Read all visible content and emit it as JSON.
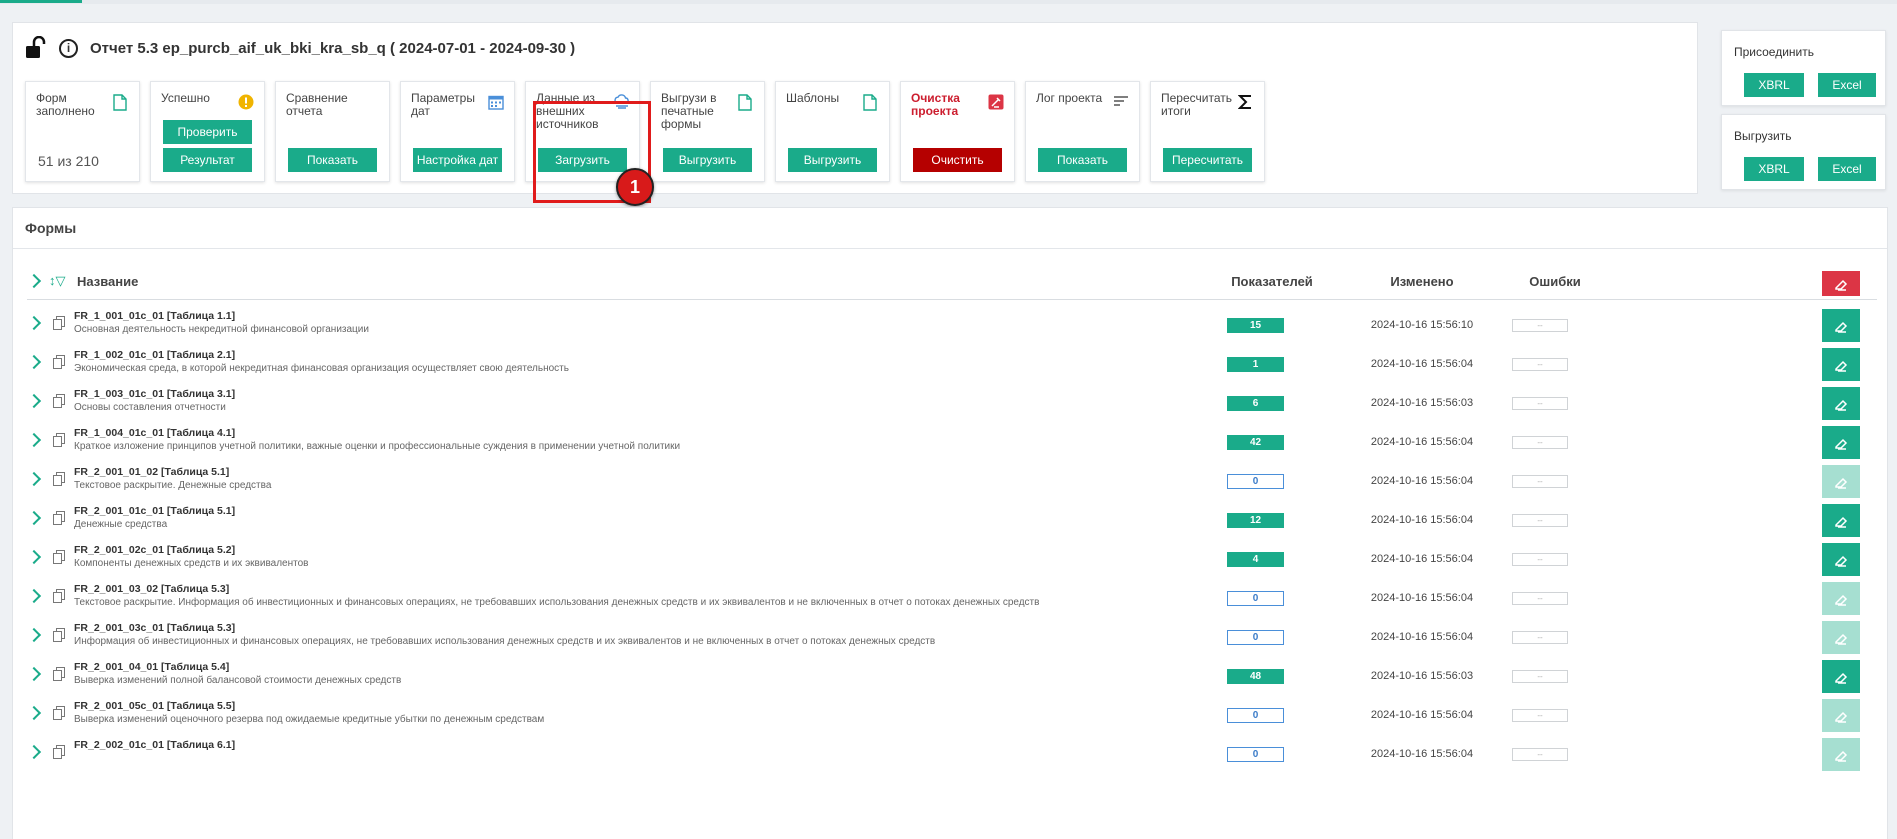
{
  "report": {
    "title": "Отчет 5.3 ep_purcb_aif_uk_bki_kra_sb_q ( 2024-07-01 - 2024-09-30 )"
  },
  "tiles": [
    {
      "label": "Форм заполнено",
      "count": "51 из 210"
    },
    {
      "label": "Успешно",
      "button1": "Проверить",
      "button2": "Результат"
    },
    {
      "label": "Сравнение отчета",
      "button2": "Показать"
    },
    {
      "label": "Параметры дат",
      "button2": "Настройка дат"
    },
    {
      "label": "Данные из внешних источников",
      "button2": "Загрузить"
    },
    {
      "label": "Выгрузи в печатные формы",
      "button2": "Выгрузить"
    },
    {
      "label": "Шаблоны",
      "button2": "Выгрузить"
    },
    {
      "label": "Очистка проекта",
      "button2": "Очистить"
    },
    {
      "label": "Лог проекта",
      "button2": "Показать"
    },
    {
      "label": "Пересчитать итоги",
      "button2": "Пересчитать"
    }
  ],
  "annotation": {
    "number": "1"
  },
  "attach": {
    "label": "Присоединить",
    "xbrl": "XBRL",
    "excel": "Excel"
  },
  "export": {
    "label": "Выгрузить",
    "xbrl": "XBRL",
    "excel": "Excel"
  },
  "forms": {
    "title": "Формы",
    "headers": {
      "name": "Название",
      "count": "Показателей",
      "modified": "Изменено",
      "errors": "Ошибки"
    },
    "rows": [
      {
        "name": "FR_1_001_01c_01 [Таблица 1.1]",
        "desc": "Основная деятельность некредитной финансовой организации",
        "count": "15",
        "filled": true,
        "modified": "2024-10-16 15:56:10",
        "errors": "--"
      },
      {
        "name": "FR_1_002_01c_01 [Таблица 2.1]",
        "desc": "Экономическая среда, в которой некредитная финансовая организация осуществляет свою деятельность",
        "count": "1",
        "filled": true,
        "modified": "2024-10-16 15:56:04",
        "errors": "--"
      },
      {
        "name": "FR_1_003_01c_01 [Таблица 3.1]",
        "desc": "Основы составления отчетности",
        "count": "6",
        "filled": true,
        "modified": "2024-10-16 15:56:03",
        "errors": "--"
      },
      {
        "name": "FR_1_004_01c_01 [Таблица 4.1]",
        "desc": "Краткое изложение принципов учетной политики, важные оценки и профессиональные суждения в применении учетной политики",
        "count": "42",
        "filled": true,
        "modified": "2024-10-16 15:56:04",
        "errors": "--"
      },
      {
        "name": "FR_2_001_01_02 [Таблица 5.1]",
        "desc": "Текстовое раскрытие. Денежные средства",
        "count": "0",
        "filled": false,
        "modified": "2024-10-16 15:56:04",
        "errors": "--"
      },
      {
        "name": "FR_2_001_01c_01 [Таблица 5.1]",
        "desc": "Денежные средства",
        "count": "12",
        "filled": true,
        "modified": "2024-10-16 15:56:04",
        "errors": "--"
      },
      {
        "name": "FR_2_001_02c_01 [Таблица 5.2]",
        "desc": "Компоненты денежных средств и их эквивалентов",
        "count": "4",
        "filled": true,
        "modified": "2024-10-16 15:56:04",
        "errors": "--"
      },
      {
        "name": "FR_2_001_03_02 [Таблица 5.3]",
        "desc": "Текстовое раскрытие. Информация об инвестиционных и финансовых операциях, не требовавших использования денежных средств и их эквивалентов и не включенных в отчет о потоках денежных средств",
        "count": "0",
        "filled": false,
        "modified": "2024-10-16 15:56:04",
        "errors": "--"
      },
      {
        "name": "FR_2_001_03c_01 [Таблица 5.3]",
        "desc": "Информация об инвестиционных и финансовых операциях, не требовавших использования денежных средств и их эквивалентов и не включенных в отчет о потоках денежных средств",
        "count": "0",
        "filled": false,
        "modified": "2024-10-16 15:56:04",
        "errors": "--"
      },
      {
        "name": "FR_2_001_04_01 [Таблица 5.4]",
        "desc": "Выверка изменений полной балансовой стоимости денежных средств",
        "count": "48",
        "filled": true,
        "modified": "2024-10-16 15:56:03",
        "errors": "--"
      },
      {
        "name": "FR_2_001_05c_01 [Таблица 5.5]",
        "desc": "Выверка изменений оценочного резерва под ожидаемые кредитные убытки по денежным средствам",
        "count": "0",
        "filled": false,
        "modified": "2024-10-16 15:56:04",
        "errors": "--"
      },
      {
        "name": "FR_2_002_01c_01 [Таблица 6.1]",
        "desc": "",
        "count": "0",
        "filled": false,
        "modified": "2024-10-16 15:56:04",
        "errors": "--"
      }
    ]
  },
  "colors": {
    "accent": "#1aab8a",
    "danger": "#b50000",
    "highlight": "#e01b1b"
  }
}
